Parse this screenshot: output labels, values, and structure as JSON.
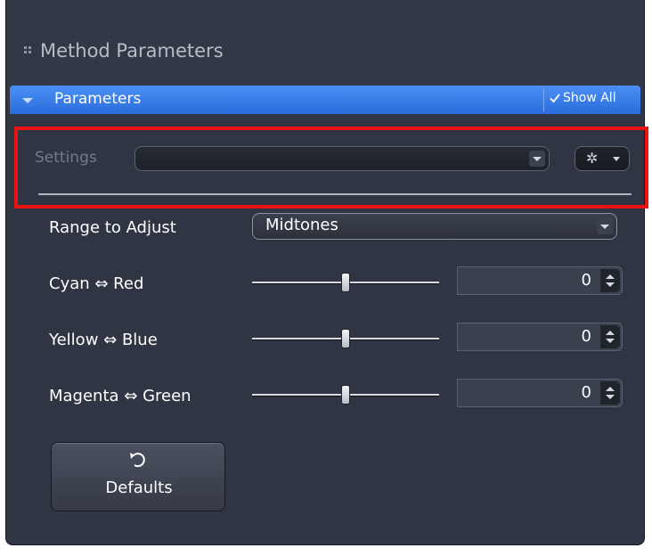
{
  "panel": {
    "title": "Method Parameters"
  },
  "section": {
    "label": "Parameters",
    "show_all_label": "Show All"
  },
  "settings": {
    "label": "Settings",
    "selected": ""
  },
  "range": {
    "label": "Range to Adjust",
    "selected": "Midtones"
  },
  "sliders": [
    {
      "label": "Cyan ⇔ Red",
      "value": "0"
    },
    {
      "label": "Yellow ⇔ Blue",
      "value": "0"
    },
    {
      "label": "Magenta ⇔ Green",
      "value": "0"
    }
  ],
  "defaults_button": {
    "label": "Defaults"
  },
  "colors": {
    "accent": "#3a7ee8",
    "highlight": "#ee1111",
    "panel_bg": "#2f3542"
  },
  "icons": [
    "grip-icon",
    "collapse-triangle-icon",
    "checkmark-icon",
    "gear-icon",
    "dropdown-arrow-icon",
    "spinner-arrows-icon",
    "undo-icon"
  ]
}
